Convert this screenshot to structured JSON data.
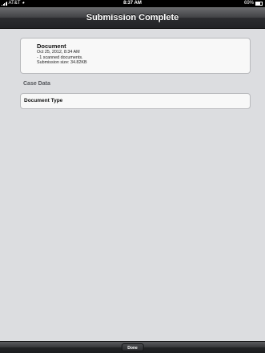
{
  "status_bar": {
    "carrier": "AT&T",
    "time": "8:37 AM",
    "battery": "69%",
    "icons": [
      "signal-icon",
      "wifi-icon",
      "battery-icon"
    ]
  },
  "nav": {
    "title": "Submission Complete"
  },
  "document": {
    "title": "Document",
    "date": "Oct 25, 2012, 8:34 AM",
    "scanned": "- 1 scanned documents.",
    "size": "Submission size: 34.82KB"
  },
  "case_data": {
    "header": "Case Data",
    "rows": [
      {
        "label": "Document Type"
      }
    ]
  },
  "toolbar": {
    "done_label": "Done"
  }
}
